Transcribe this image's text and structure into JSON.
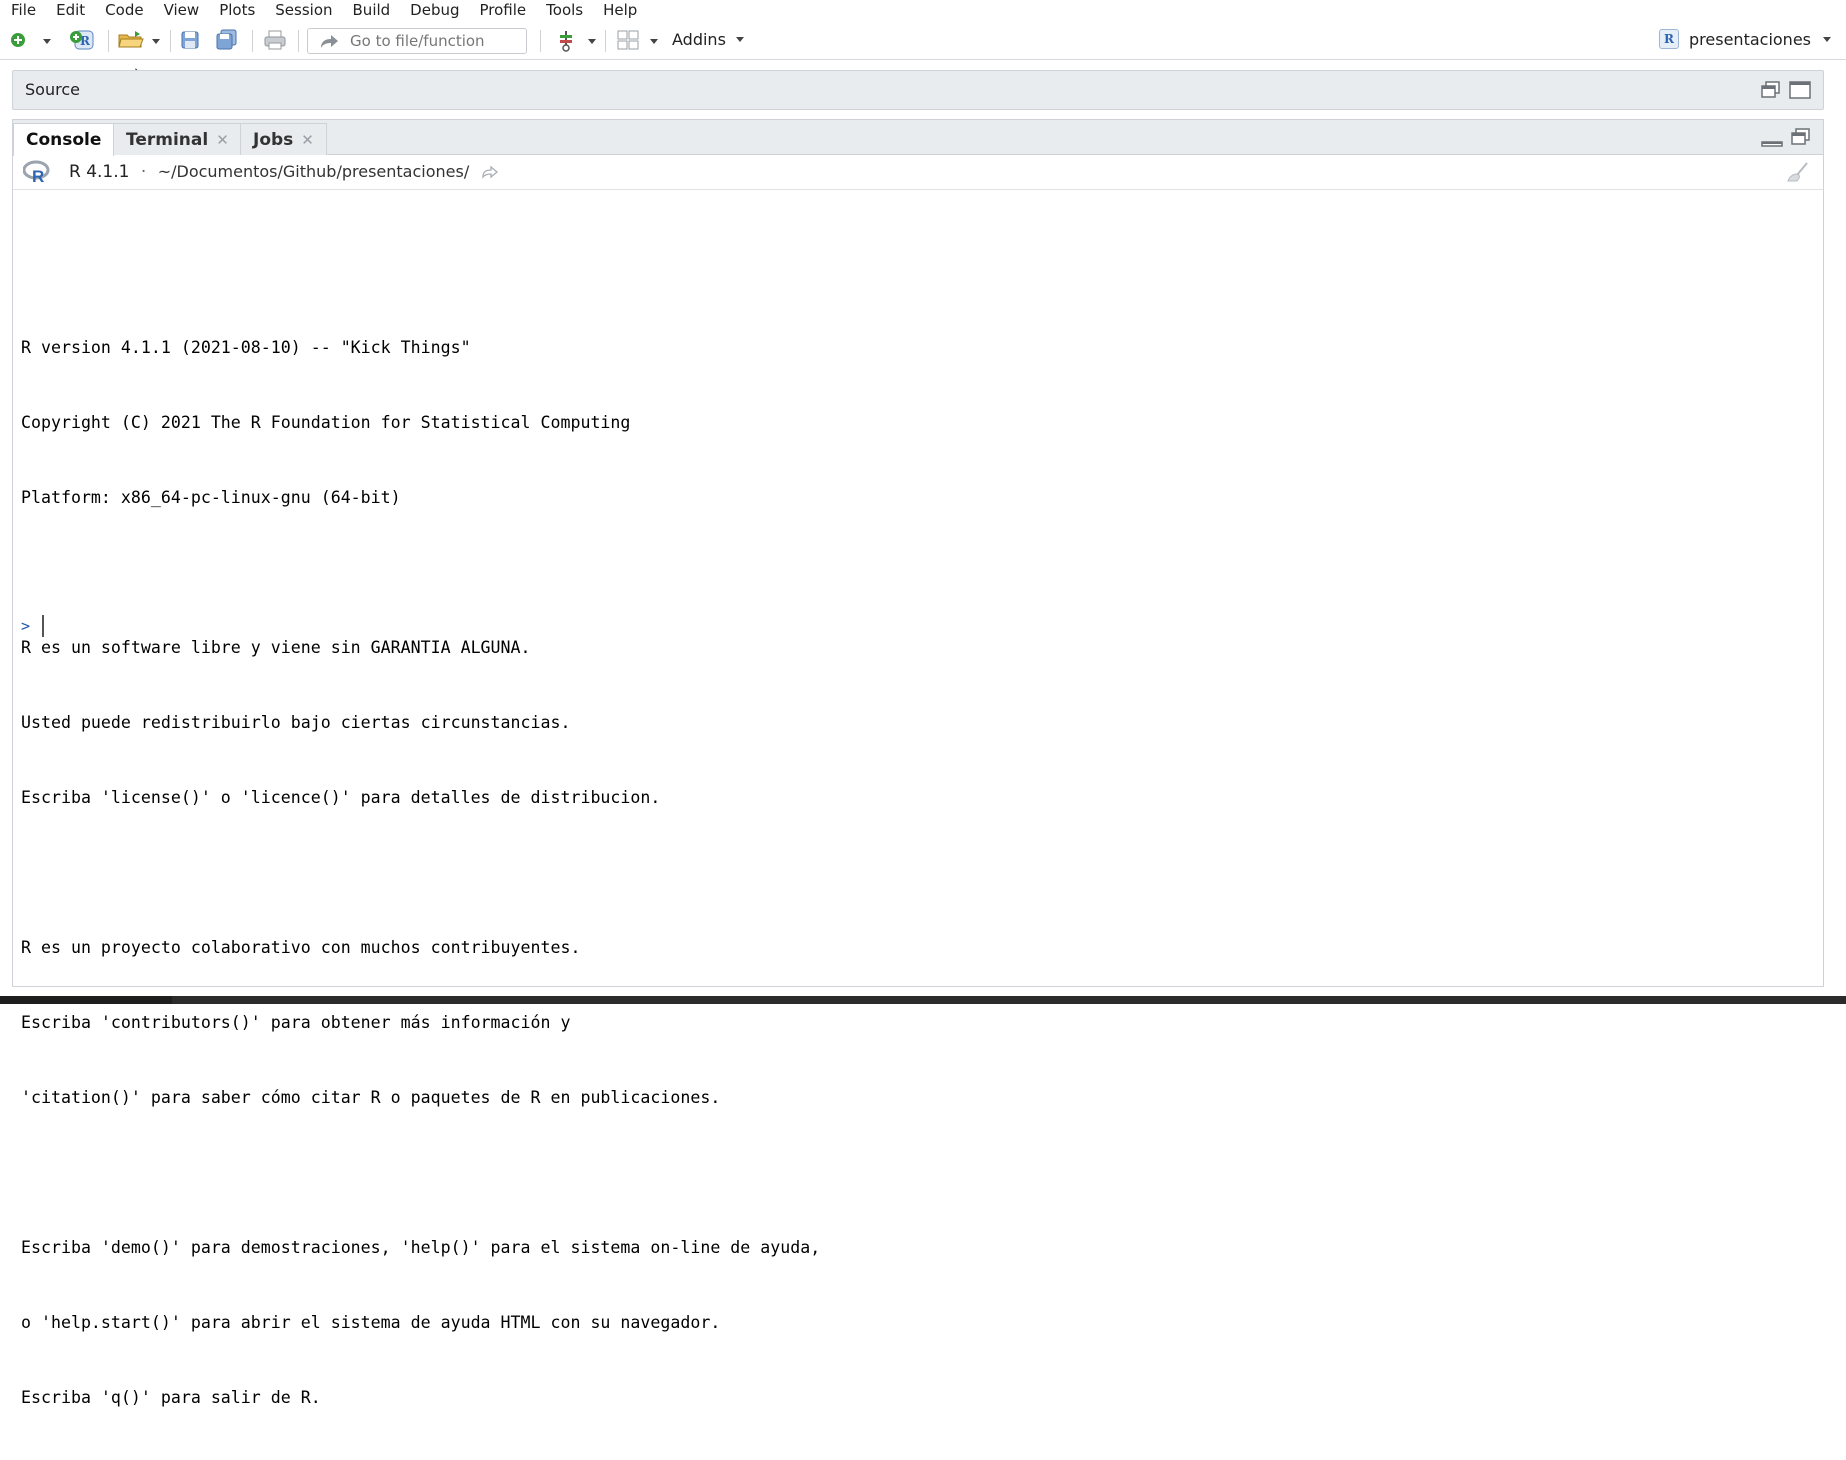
{
  "menubar": {
    "items": [
      {
        "label": "File"
      },
      {
        "label": "Edit"
      },
      {
        "label": "Code"
      },
      {
        "label": "View"
      },
      {
        "label": "Plots"
      },
      {
        "label": "Session"
      },
      {
        "label": "Build"
      },
      {
        "label": "Debug"
      },
      {
        "label": "Profile"
      },
      {
        "label": "Tools"
      },
      {
        "label": "Help"
      }
    ]
  },
  "toolbar": {
    "goto_placeholder": "Go to file/function",
    "addins_label": "Addins",
    "project_label": "presentaciones",
    "icons": [
      "new-file-icon",
      "new-project-icon",
      "open-folder-icon",
      "save-icon",
      "save-all-icon",
      "print-icon",
      "git-icon",
      "grid-layout-icon"
    ]
  },
  "source_pane": {
    "title": "Source"
  },
  "console_pane": {
    "tabs": [
      {
        "label": "Console",
        "active": true,
        "closable": false
      },
      {
        "label": "Terminal",
        "active": false,
        "closable": true
      },
      {
        "label": "Jobs",
        "active": false,
        "closable": true
      }
    ],
    "r_version": "R 4.1.1",
    "separator": "·",
    "working_dir": "~/Documentos/Github/presentaciones/",
    "output_lines": [
      "",
      "R version 4.1.1 (2021-08-10) -- \"Kick Things\"",
      "Copyright (C) 2021 The R Foundation for Statistical Computing",
      "Platform: x86_64-pc-linux-gnu (64-bit)",
      "",
      "R es un software libre y viene sin GARANTIA ALGUNA.",
      "Usted puede redistribuirlo bajo ciertas circunstancias.",
      "Escriba 'license()' o 'licence()' para detalles de distribucion.",
      "",
      "R es un proyecto colaborativo con muchos contribuyentes.",
      "Escriba 'contributors()' para obtener más información y",
      "'citation()' para saber cómo citar R o paquetes de R en publicaciones.",
      "",
      "Escriba 'demo()' para demostraciones, 'help()' para el sistema on-line de ayuda,",
      "o 'help.start()' para abrir el sistema de ayuda HTML con su navegador.",
      "Escriba 'q()' para salir de R."
    ],
    "prompt": ">"
  },
  "colors": {
    "accent_blue": "#2d64b3",
    "pane_header": "#e9ecef",
    "border": "#cfd3d7"
  }
}
